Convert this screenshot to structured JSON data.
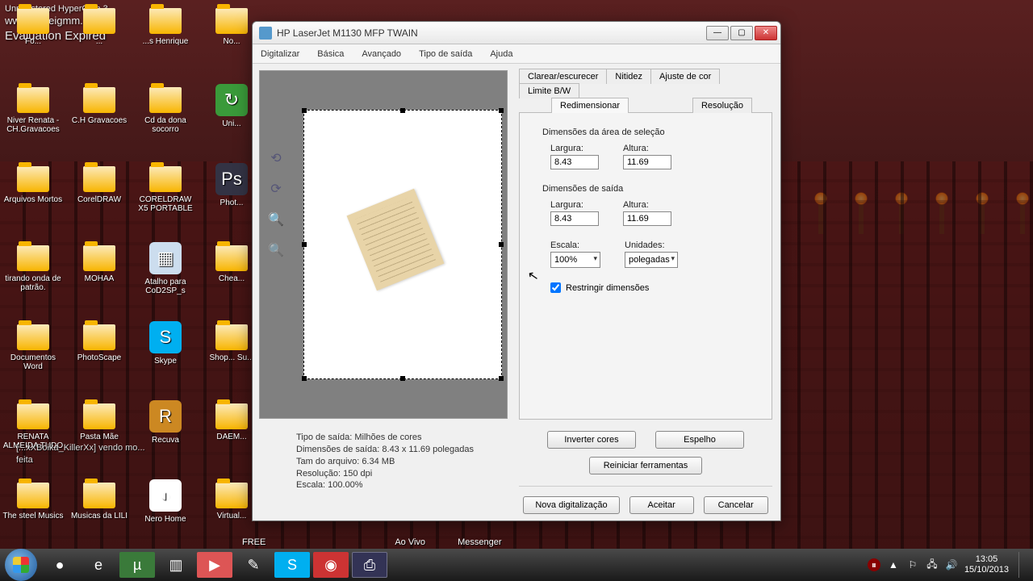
{
  "watermark": {
    "l1": "Unregistered HyperCam 3",
    "l2": "www.solveigmm.com",
    "l3": "Evaluation Expired"
  },
  "desktop_icons": [
    {
      "label": "Fo...",
      "type": "folder"
    },
    {
      "label": "...",
      "type": "folder"
    },
    {
      "label": "...s Henrique",
      "type": "folder"
    },
    {
      "label": "No...",
      "type": "folder"
    },
    {
      "label": "Niver Renata - CH.Gravacoes",
      "type": "folder"
    },
    {
      "label": "C.H Gravacoes",
      "type": "folder"
    },
    {
      "label": "Cd da dona socorro",
      "type": "folder"
    },
    {
      "label": "Uni...",
      "type": "app",
      "bg": "#3a9a3a",
      "glyph": "↻"
    },
    {
      "label": "Arquivos Mortos",
      "type": "folder"
    },
    {
      "label": "CorelDRAW",
      "type": "folder"
    },
    {
      "label": "CORELDRAW X5 PORTABLE",
      "type": "folder"
    },
    {
      "label": "Phot...",
      "type": "app",
      "bg": "#334",
      "glyph": "Ps"
    },
    {
      "label": "tirando onda de patrão.",
      "type": "folder"
    },
    {
      "label": "MOHAA",
      "type": "folder"
    },
    {
      "label": "Atalho para CoD2SP_s",
      "type": "app",
      "bg": "#cde",
      "glyph": "▦"
    },
    {
      "label": "Chea...",
      "type": "folder"
    },
    {
      "label": "Documentos Word",
      "type": "folder"
    },
    {
      "label": "PhotoScape",
      "type": "folder"
    },
    {
      "label": "Skype",
      "type": "app",
      "bg": "#00aff0",
      "glyph": "S"
    },
    {
      "label": "Shop... Su...",
      "type": "folder"
    },
    {
      "label": "RENATA ALMEIDA TUDO",
      "type": "folder"
    },
    {
      "label": "Pasta Mãe",
      "type": "folder"
    },
    {
      "label": "Recuva",
      "type": "app",
      "bg": "#c82",
      "glyph": "R"
    },
    {
      "label": "DAEM...",
      "type": "folder"
    },
    {
      "label": "The steel Musics",
      "type": "folder"
    },
    {
      "label": "Musicas da LILI",
      "type": "folder"
    },
    {
      "label": "Nero Home",
      "type": "app",
      "bg": "#fff",
      "glyph": "◐"
    },
    {
      "label": "Virtual...",
      "type": "folder"
    }
  ],
  "quicklabels": [
    "FREE",
    "Ao Vivo",
    "Messenger"
  ],
  "chat": {
    "l1": "[...xXBoika_KillerXx] vendo mo...",
    "l2": "feita"
  },
  "win": {
    "title": "HP LaserJet M1130 MFP TWAIN",
    "menu": [
      "Digitalizar",
      "Básica",
      "Avançado",
      "Tipo de saída",
      "Ajuda"
    ],
    "tabs_row1": [
      "Clarear/escurecer",
      "Nitidez",
      "Ajuste de cor",
      "Limite B/W"
    ],
    "tabs_row2": [
      "Redimensionar",
      "Resolução"
    ],
    "sel_area": {
      "title": "Dimensões da área de seleção",
      "w_label": "Largura:",
      "w": "8.43",
      "h_label": "Altura:",
      "h": "11.69"
    },
    "out_dim": {
      "title": "Dimensões de saída",
      "w_label": "Largura:",
      "w": "8.43",
      "h_label": "Altura:",
      "h": "11.69"
    },
    "scale": {
      "label": "Escala:",
      "value": "100%"
    },
    "units": {
      "label": "Unidades:",
      "value": "polegadas"
    },
    "restrict": {
      "label": "Restringir dimensões",
      "checked": true
    },
    "buttons": {
      "invert": "Inverter cores",
      "mirror": "Espelho",
      "reset": "Reiniciar ferramentas",
      "new": "Nova digitalização",
      "accept": "Aceitar",
      "cancel": "Cancelar"
    },
    "meta": {
      "l1": "Tipo de saída:  Milhões de cores",
      "l2": "Dimensões de saída:  8.43 x 11.69 polegadas",
      "l3": "Tam do arquivo:  6.34 MB",
      "l4": "Resolução:  150 dpi",
      "l5": "Escala:  100.00%"
    }
  },
  "taskbar": {
    "items": [
      {
        "glyph": "●",
        "bg": "",
        "name": "chrome"
      },
      {
        "glyph": "e",
        "bg": "",
        "name": "ie"
      },
      {
        "glyph": "µ",
        "bg": "#3a7a3a",
        "name": "utorrent"
      },
      {
        "glyph": "▥",
        "bg": "",
        "name": "explorer"
      },
      {
        "glyph": "▶",
        "bg": "#d55",
        "name": "media"
      },
      {
        "glyph": "✎",
        "bg": "",
        "name": "notes"
      },
      {
        "glyph": "S",
        "bg": "#00aff0",
        "name": "skype"
      },
      {
        "glyph": "◉",
        "bg": "#c33",
        "name": "record"
      },
      {
        "glyph": "⎙",
        "bg": "#335",
        "name": "scanner",
        "active": true
      }
    ],
    "clock": {
      "time": "13:05",
      "date": "15/10/2013"
    }
  }
}
